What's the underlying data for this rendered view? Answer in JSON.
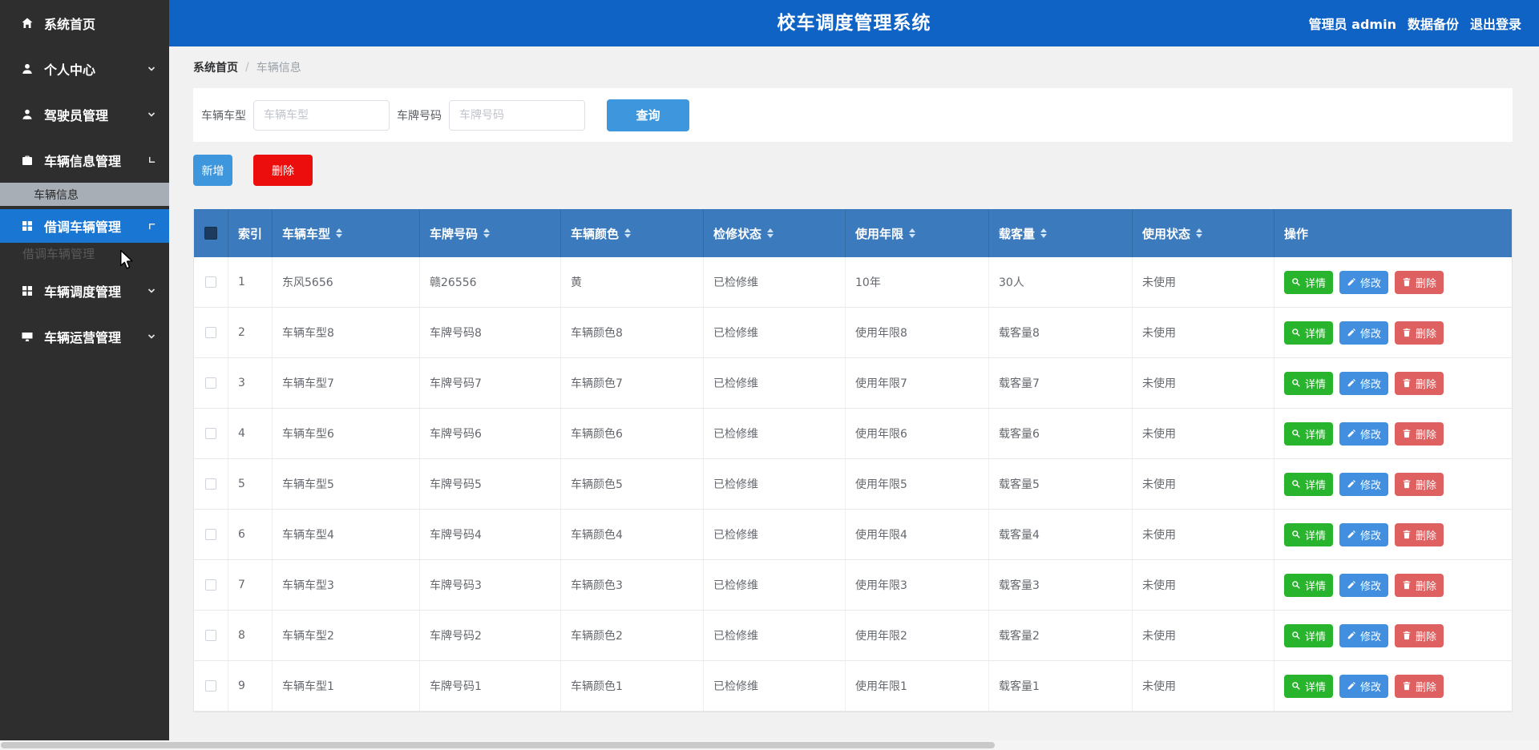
{
  "app": {
    "title": "校车调度管理系统"
  },
  "header": {
    "user": "管理员 admin",
    "backup": "数据备份",
    "logout": "退出登录"
  },
  "sidebar": {
    "items": [
      {
        "name": "home",
        "label": "系统首页",
        "icon": "home-icon",
        "style": "item"
      },
      {
        "name": "profile",
        "label": "个人中心",
        "icon": "user-icon",
        "style": "item",
        "chevron": "chevron-down"
      },
      {
        "name": "driver-management",
        "label": "驾驶员管理",
        "icon": "driver-icon",
        "style": "item",
        "chevron": "chevron-down"
      },
      {
        "name": "vehicle-info-management",
        "label": "车辆信息管理",
        "icon": "vehicle-info-icon",
        "style": "item",
        "chevron": "corner-bl"
      },
      {
        "name": "vehicle-info",
        "label": "车辆信息",
        "style": "sub-active"
      },
      {
        "name": "borrow-vehicle-management",
        "label": "借调车辆管理",
        "icon": "grid-icon",
        "style": "item-active",
        "chevron": "corner-tl"
      },
      {
        "name": "borrow-vehicle-partial",
        "label": "借调车辆管理",
        "style": "partial"
      },
      {
        "name": "dispatch-management",
        "label": "车辆调度管理",
        "icon": "grid-icon",
        "style": "item",
        "chevron": "chevron-down"
      },
      {
        "name": "operation-management",
        "label": "车辆运营管理",
        "icon": "monitor-icon",
        "style": "item",
        "chevron": "chevron-down"
      }
    ]
  },
  "breadcrumb": {
    "home": "系统首页",
    "separator": "/",
    "current": "车辆信息"
  },
  "filters": {
    "model_label": "车辆车型",
    "model_placeholder": "车辆车型",
    "plate_label": "车牌号码",
    "plate_placeholder": "车牌号码",
    "query_button": "查询"
  },
  "actions": {
    "add": "新增",
    "delete": "删除"
  },
  "table": {
    "columns": [
      {
        "key": "index",
        "label": "索引",
        "sortable": false
      },
      {
        "key": "model",
        "label": "车辆车型",
        "sortable": true
      },
      {
        "key": "plate",
        "label": "车牌号码",
        "sortable": true
      },
      {
        "key": "color",
        "label": "车辆颜色",
        "sortable": true
      },
      {
        "key": "repair",
        "label": "检修状态",
        "sortable": true
      },
      {
        "key": "years",
        "label": "使用年限",
        "sortable": true
      },
      {
        "key": "capacity",
        "label": "载客量",
        "sortable": true
      },
      {
        "key": "status",
        "label": "使用状态",
        "sortable": true
      },
      {
        "key": "actions",
        "label": "操作",
        "sortable": false
      }
    ],
    "rows": [
      {
        "index": "1",
        "model": "东风5656",
        "plate": "赣26556",
        "color": "黄",
        "repair": "已检修维",
        "years": "10年",
        "capacity": "30人",
        "status": "未使用"
      },
      {
        "index": "2",
        "model": "车辆车型8",
        "plate": "车牌号码8",
        "color": "车辆颜色8",
        "repair": "已检修维",
        "years": "使用年限8",
        "capacity": "载客量8",
        "status": "未使用"
      },
      {
        "index": "3",
        "model": "车辆车型7",
        "plate": "车牌号码7",
        "color": "车辆颜色7",
        "repair": "已检修维",
        "years": "使用年限7",
        "capacity": "载客量7",
        "status": "未使用"
      },
      {
        "index": "4",
        "model": "车辆车型6",
        "plate": "车牌号码6",
        "color": "车辆颜色6",
        "repair": "已检修维",
        "years": "使用年限6",
        "capacity": "载客量6",
        "status": "未使用"
      },
      {
        "index": "5",
        "model": "车辆车型5",
        "plate": "车牌号码5",
        "color": "车辆颜色5",
        "repair": "已检修维",
        "years": "使用年限5",
        "capacity": "载客量5",
        "status": "未使用"
      },
      {
        "index": "6",
        "model": "车辆车型4",
        "plate": "车牌号码4",
        "color": "车辆颜色4",
        "repair": "已检修维",
        "years": "使用年限4",
        "capacity": "载客量4",
        "status": "未使用"
      },
      {
        "index": "7",
        "model": "车辆车型3",
        "plate": "车牌号码3",
        "color": "车辆颜色3",
        "repair": "已检修维",
        "years": "使用年限3",
        "capacity": "载客量3",
        "status": "未使用"
      },
      {
        "index": "8",
        "model": "车辆车型2",
        "plate": "车牌号码2",
        "color": "车辆颜色2",
        "repair": "已检修维",
        "years": "使用年限2",
        "capacity": "载客量2",
        "status": "未使用"
      },
      {
        "index": "9",
        "model": "车辆车型1",
        "plate": "车牌号码1",
        "color": "车辆颜色1",
        "repair": "已检修维",
        "years": "使用年限1",
        "capacity": "载客量1",
        "status": "未使用"
      }
    ],
    "row_actions": [
      {
        "kind": "detail",
        "label": "详情",
        "icon": "search-icon"
      },
      {
        "kind": "edit",
        "label": "修改",
        "icon": "edit-icon"
      },
      {
        "kind": "delete",
        "label": "删除",
        "icon": "trash-icon"
      }
    ]
  },
  "colors": {
    "topbar": "#0f63c5",
    "table_header": "#3a7abd",
    "sidebar": "#2e2e2e",
    "sidebar_active": "#1976d2",
    "sub_active_bar": "#a8aeb6",
    "primary_button": "#3e96dd",
    "danger_button": "#ec0d0d",
    "detail_button": "#28b42c",
    "edit_button": "#418fde",
    "row_delete_button": "#de6060"
  }
}
